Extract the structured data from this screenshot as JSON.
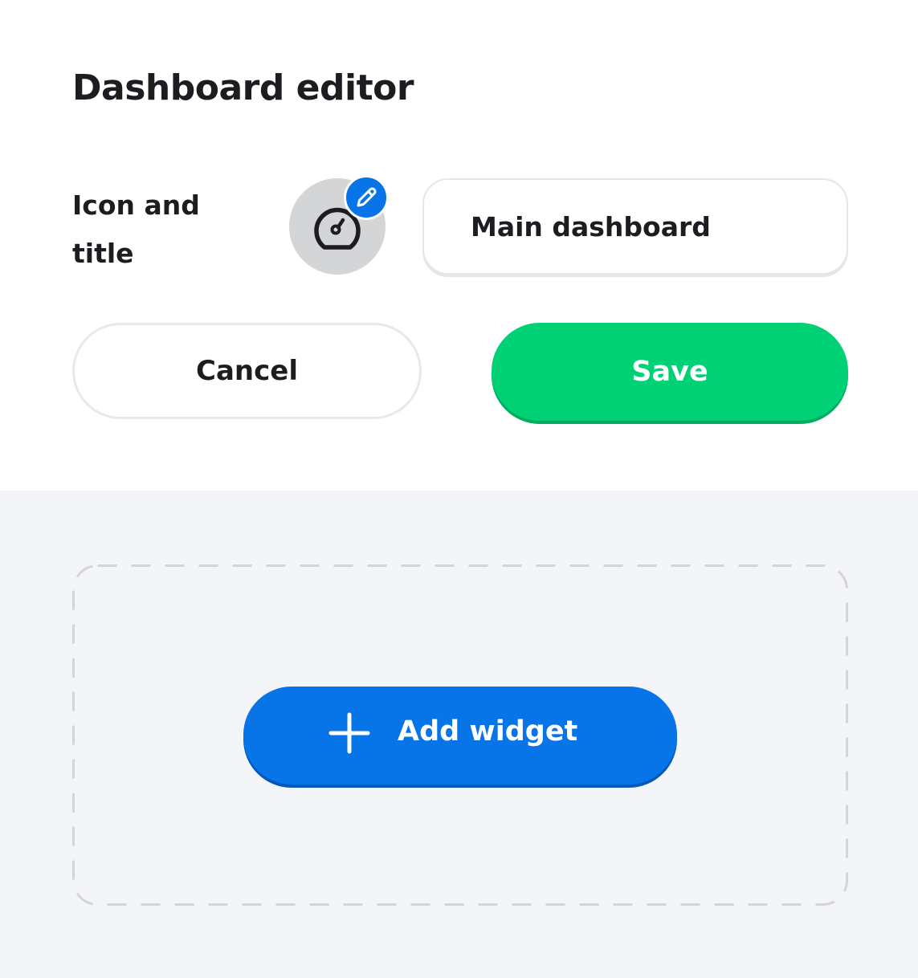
{
  "header": {
    "title": "Dashboard editor"
  },
  "icon_and_title": {
    "label": "Icon and title",
    "icon": "gauge-icon",
    "edit_icon": "pencil-icon",
    "title_value": "Main dashboard"
  },
  "actions": {
    "cancel_label": "Cancel",
    "save_label": "Save"
  },
  "widgets": {
    "add_label": "Add widget",
    "add_icon": "plus-icon"
  },
  "colors": {
    "save_green": "#00d175",
    "primary_blue": "#0774e8",
    "canvas_background": "#f4f5f9"
  }
}
